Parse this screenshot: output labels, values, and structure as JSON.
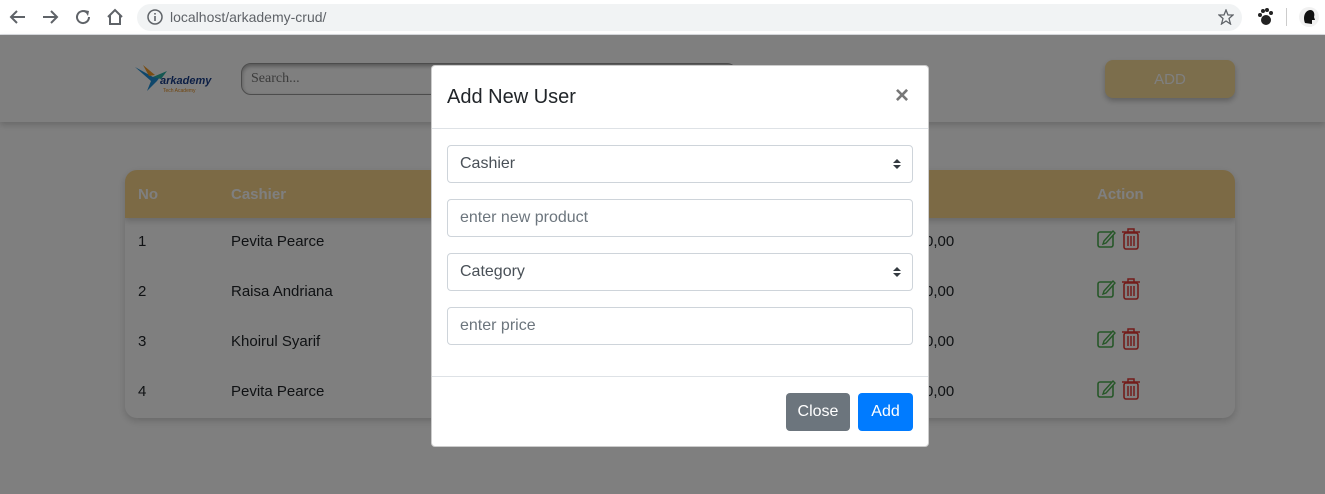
{
  "browser": {
    "url": "localhost/arkademy-crud/"
  },
  "navbar": {
    "logo_text": "arkademy",
    "logo_subtext": "Tech Academy",
    "search_placeholder": "Search...",
    "add_button": "ADD"
  },
  "table": {
    "headers": {
      "no": "No",
      "cashier": "Cashier",
      "action": "Action"
    },
    "rows": [
      {
        "no": "1",
        "cashier": "Pevita Pearce",
        "price": "0,00"
      },
      {
        "no": "2",
        "cashier": "Raisa Andriana",
        "price": "0,00"
      },
      {
        "no": "3",
        "cashier": "Khoirul Syarif",
        "price": "0,00"
      },
      {
        "no": "4",
        "cashier": "Pevita Pearce",
        "price": "0,00"
      }
    ]
  },
  "modal": {
    "title": "Add New User",
    "close_symbol": "×",
    "cashier_select": "Cashier",
    "product_placeholder": "enter new product",
    "category_select": "Category",
    "price_placeholder": "enter price",
    "close_button": "Close",
    "add_button": "Add"
  },
  "colors": {
    "accent_yellow": "#f8d48a",
    "primary_blue": "#007bff",
    "secondary_gray": "#6c757d",
    "edit_green": "#4caf50",
    "delete_red": "#e53935"
  }
}
